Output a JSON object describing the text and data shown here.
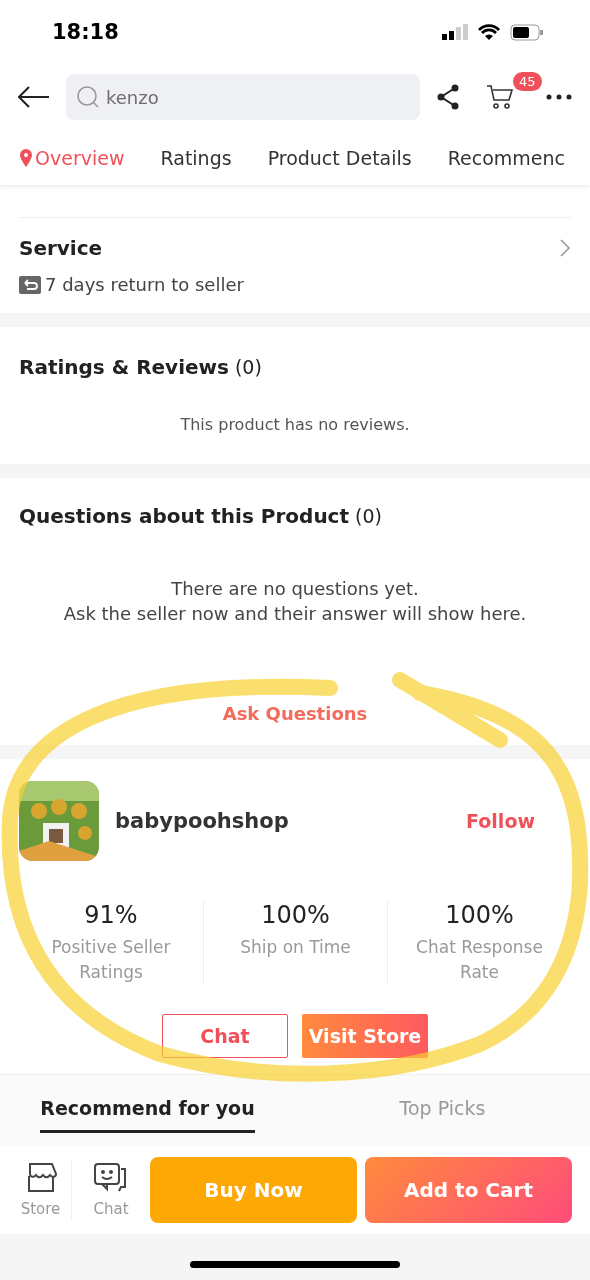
{
  "status_bar": {
    "time": "18:18"
  },
  "header": {
    "search": {
      "value": "kenzo"
    },
    "cart_count": "45"
  },
  "tabs": [
    {
      "label": "Overview",
      "selected": true
    },
    {
      "label": "Ratings",
      "selected": false
    },
    {
      "label": "Product Details",
      "selected": false
    },
    {
      "label": "Recommenc",
      "selected": false
    }
  ],
  "service": {
    "title": "Service",
    "items": [
      "7 days return to seller"
    ]
  },
  "ratings": {
    "title": "Ratings & Reviews",
    "count": "(0)",
    "empty": "This product has no reviews."
  },
  "questions": {
    "title": "Questions about this Product",
    "count": "(0)",
    "empty_lines": [
      "There are no questions yet.",
      "Ask the seller now and their answer will show here."
    ],
    "action": "Ask Questions"
  },
  "seller": {
    "name": "babypoohshop",
    "follow": "Follow",
    "stats": [
      {
        "value": "91%",
        "label": "Positive Seller Ratings"
      },
      {
        "value": "100%",
        "label": "Ship on Time"
      },
      {
        "value": "100%",
        "label": "Chat Response Rate"
      }
    ],
    "buttons": [
      {
        "kind": "outline",
        "label": "Chat"
      },
      {
        "kind": "filled",
        "label": "Visit Store"
      }
    ]
  },
  "recommend_tabs": [
    {
      "label": "Recommend for you",
      "selected": true
    },
    {
      "label": "Top Picks",
      "selected": false
    }
  ],
  "bottom_bar": {
    "icons": [
      {
        "kind": "store",
        "label": "Store"
      },
      {
        "kind": "chat",
        "label": "Chat"
      }
    ],
    "buttons": [
      {
        "kind": "buy",
        "label": "Buy Now"
      },
      {
        "kind": "cart",
        "label": "Add to Cart"
      }
    ]
  },
  "annotation": {
    "kind": "highlight"
  }
}
